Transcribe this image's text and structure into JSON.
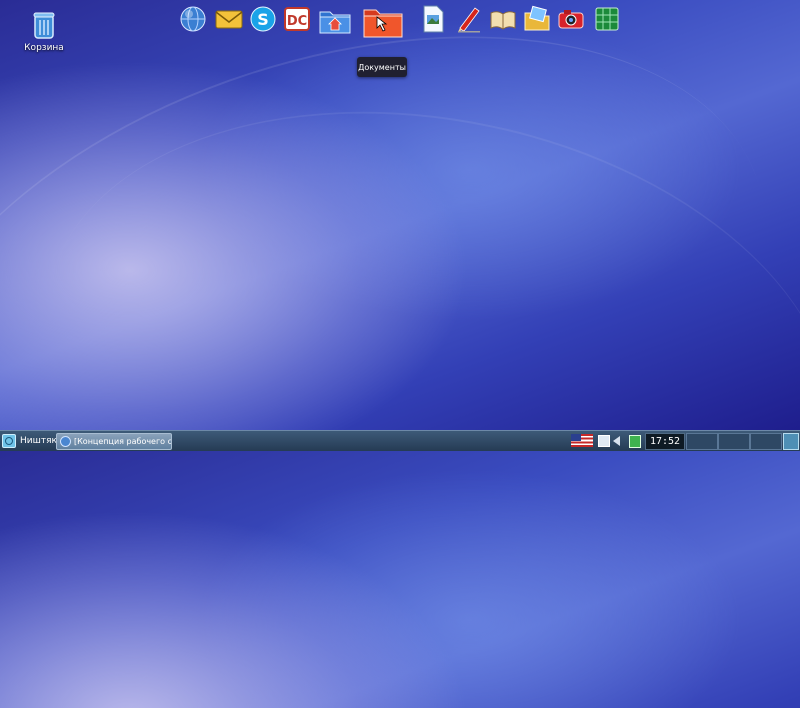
{
  "desktop": {
    "icons": [
      {
        "label": "Корзина",
        "icon": "trash-bin-icon"
      }
    ]
  },
  "dock": {
    "items": [
      {
        "icon": "globe-browser-icon"
      },
      {
        "icon": "mail-icon"
      },
      {
        "icon": "skype-icon"
      },
      {
        "icon": "dc-filemanager-icon"
      },
      {
        "icon": "home-folder-icon"
      },
      {
        "icon": "documents-folder-icon"
      },
      {
        "icon": "image-viewer-icon"
      },
      {
        "icon": "text-editor-icon"
      },
      {
        "icon": "dictionary-book-icon"
      },
      {
        "icon": "photo-folder-icon"
      },
      {
        "icon": "camera-icon"
      },
      {
        "icon": "spreadsheet-icon"
      }
    ],
    "tooltip": "Документы"
  },
  "taskbar": {
    "start_label": "Ништяки",
    "task_label": "[Концепция рабочего стол...",
    "clock": "17:52",
    "keyboard_layout_icon": "us-flag-icon"
  },
  "colors": {
    "taskbar": "#2f4a66",
    "tooltip_bg": "#202030",
    "desktop_accent": "#3a4cc0"
  }
}
